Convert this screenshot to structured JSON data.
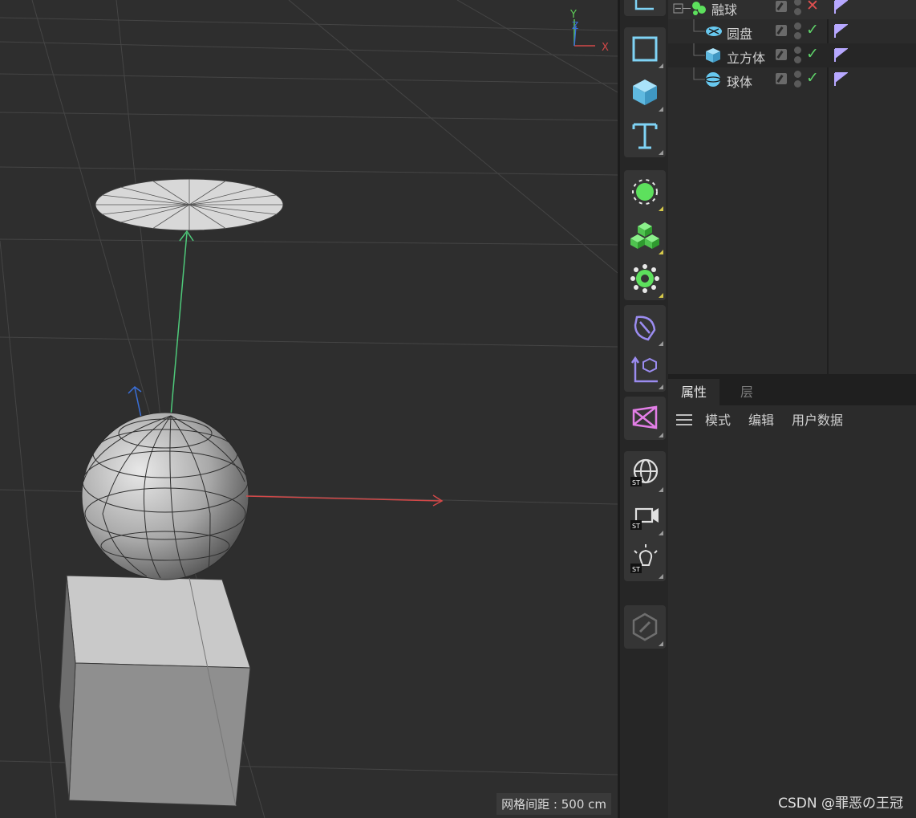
{
  "viewport": {
    "grid_spacing_label": "网格间距 : 500 cm",
    "axis_labels": {
      "y": "Y",
      "z": "Z",
      "x": "X"
    }
  },
  "toolbar": {
    "tools": [
      {
        "name": "cube-primitive-icon"
      },
      {
        "name": "text-spline-icon"
      },
      {
        "name": "rectangle-spline-icon"
      },
      {
        "name": "null-object-icon"
      },
      {
        "name": "subdivision-icon"
      },
      {
        "name": "deformer-icon"
      },
      {
        "name": "field-icon"
      },
      {
        "name": "spline-pen-icon"
      },
      {
        "name": "coordinate-icon"
      },
      {
        "name": "mograph-icon"
      },
      {
        "name": "environment-icon"
      },
      {
        "name": "camera-icon"
      },
      {
        "name": "light-icon"
      },
      {
        "name": "edit-disabled-icon"
      }
    ],
    "colors": {
      "accent_cyan": "#68c9f0",
      "accent_green": "#6be06b",
      "accent_purple": "#9b8cf0",
      "accent_pink": "#e27ee6"
    }
  },
  "objects": {
    "rows": [
      {
        "label": "融球",
        "icon": "metaball-icon",
        "status": "✕",
        "status_color": "#e05050"
      },
      {
        "label": "圆盘",
        "icon": "disc-icon",
        "status": "✓",
        "status_color": "#5fd36a"
      },
      {
        "label": "立方体",
        "icon": "cube-icon",
        "status": "✓",
        "status_color": "#5fd36a"
      },
      {
        "label": "球体",
        "icon": "sphere-icon",
        "status": "✓",
        "status_color": "#5fd36a"
      }
    ]
  },
  "attributes": {
    "tabs": [
      {
        "label": "属性"
      },
      {
        "label": "层"
      }
    ],
    "menu": [
      {
        "label": "模式"
      },
      {
        "label": "编辑"
      },
      {
        "label": "用户数据"
      }
    ]
  },
  "watermark": "CSDN @罪恶の王冠"
}
